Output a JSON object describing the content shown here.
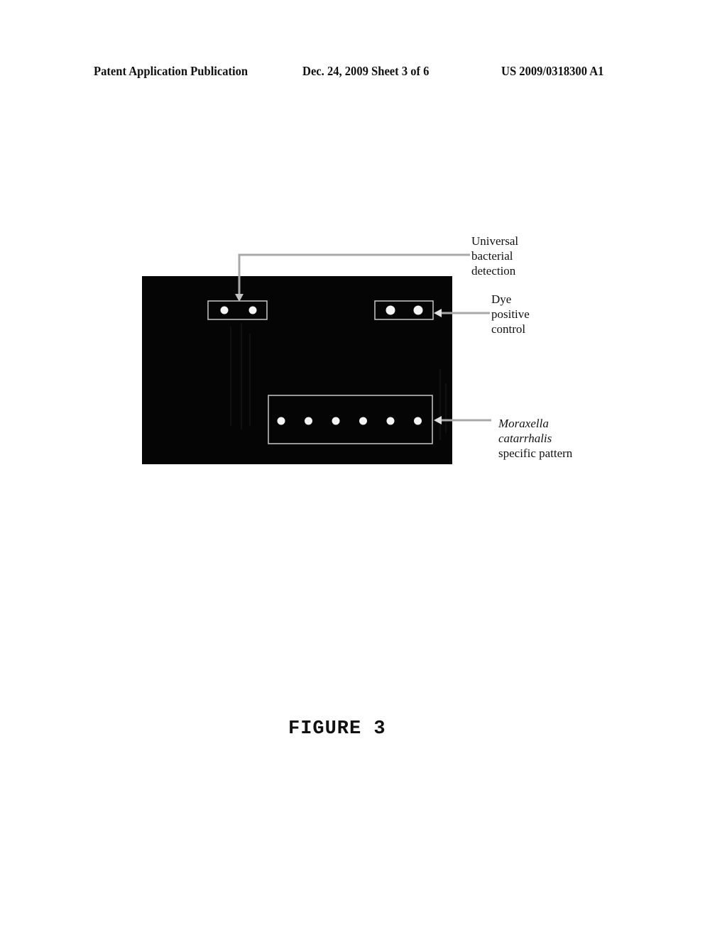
{
  "header": {
    "left": "Patent Application Publication",
    "middle": "Dec. 24, 2009   Sheet 3 of 6",
    "right": "US 2009/0318300 A1"
  },
  "figure": {
    "caption": "FIGURE 3",
    "annotations": {
      "universal": [
        "Universal",
        "bacterial",
        "detection"
      ],
      "dye": [
        "Dye",
        "positive",
        "control"
      ],
      "moraxella": {
        "genus": "Moraxella",
        "species": "catarrhalis",
        "suffix": "specific pattern"
      }
    },
    "groups": [
      {
        "name": "universal-bacterial-detection",
        "spot_count": 2
      },
      {
        "name": "dye-positive-control",
        "spot_count": 2
      },
      {
        "name": "moraxella-catarrhalis-pattern",
        "spot_count": 6
      }
    ],
    "colors": {
      "array_background": "#050505",
      "spot": "#f4f4f4",
      "box_outline": "#c8c8c8",
      "arrow": "#b0b0b0"
    }
  }
}
